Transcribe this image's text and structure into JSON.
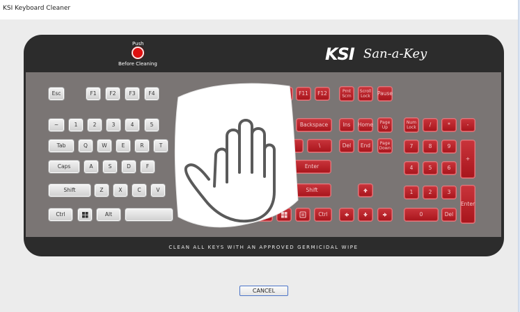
{
  "window": {
    "title": "KSI Keyboard Cleaner"
  },
  "header": {
    "push_label": "Push",
    "before_label": "Before Cleaning",
    "logo_ksi": "KSI",
    "logo_san": "San-a-Key"
  },
  "footer_text": "CLEAN ALL KEYS WITH AN APPROVED GERMICIDAL WIPE",
  "cancel_label": "CANCEL",
  "colors": {
    "key_clean": "#ececec",
    "key_dirty": "#b51f26",
    "frame": "#2c2c2c",
    "push_button": "#e01010"
  },
  "icons": [
    "windows-icon",
    "menu-icon",
    "hand-icon",
    "arrow-up-icon",
    "arrow-down-icon",
    "arrow-left-icon",
    "arrow-right-icon"
  ],
  "keys": [
    {
      "id": "esc",
      "label": "Esc",
      "state": "clean"
    },
    {
      "id": "f1",
      "label": "F1",
      "state": "clean"
    },
    {
      "id": "f2",
      "label": "F2",
      "state": "clean"
    },
    {
      "id": "f3",
      "label": "F3",
      "state": "clean"
    },
    {
      "id": "f4",
      "label": "F4",
      "state": "clean"
    },
    {
      "id": "f10",
      "label": "",
      "state": "dirty"
    },
    {
      "id": "f10b",
      "label": "",
      "state": "dirty"
    },
    {
      "id": "f11",
      "label": "F11",
      "state": "dirty"
    },
    {
      "id": "f12",
      "label": "F12",
      "state": "dirty"
    },
    {
      "id": "prtsc",
      "label": "Prnt Scrn",
      "state": "dirty"
    },
    {
      "id": "scrlk",
      "label": "Scroll Lock",
      "state": "dirty"
    },
    {
      "id": "pause",
      "label": "Pause",
      "state": "dirty"
    },
    {
      "id": "tilde",
      "label": "~",
      "state": "clean"
    },
    {
      "id": "n1",
      "label": "1",
      "state": "clean"
    },
    {
      "id": "n2",
      "label": "2",
      "state": "clean"
    },
    {
      "id": "n3",
      "label": "3",
      "state": "clean"
    },
    {
      "id": "n4",
      "label": "4",
      "state": "clean"
    },
    {
      "id": "n5",
      "label": "5",
      "state": "clean"
    },
    {
      "id": "bksp",
      "label": "Backspace",
      "state": "dirty"
    },
    {
      "id": "ins",
      "label": "Ins",
      "state": "dirty"
    },
    {
      "id": "home",
      "label": "Home",
      "state": "dirty"
    },
    {
      "id": "pgup",
      "label": "Page Up",
      "state": "dirty"
    },
    {
      "id": "numlk",
      "label": "Num Lock",
      "state": "dirty"
    },
    {
      "id": "np_div",
      "label": "/",
      "state": "dirty"
    },
    {
      "id": "np_mul",
      "label": "*",
      "state": "dirty"
    },
    {
      "id": "np_sub",
      "label": "-",
      "state": "dirty"
    },
    {
      "id": "tab",
      "label": "Tab",
      "state": "clean"
    },
    {
      "id": "q",
      "label": "Q",
      "state": "clean"
    },
    {
      "id": "w",
      "label": "W",
      "state": "clean"
    },
    {
      "id": "e",
      "label": "E",
      "state": "clean"
    },
    {
      "id": "r",
      "label": "R",
      "state": "clean"
    },
    {
      "id": "t",
      "label": "T",
      "state": "clean"
    },
    {
      "id": "rbrk",
      "label": "",
      "state": "dirty"
    },
    {
      "id": "bslash",
      "label": "\\",
      "state": "dirty"
    },
    {
      "id": "del",
      "label": "Del",
      "state": "dirty"
    },
    {
      "id": "end",
      "label": "End",
      "state": "dirty"
    },
    {
      "id": "pgdn",
      "label": "Page Down",
      "state": "dirty"
    },
    {
      "id": "np7",
      "label": "7",
      "state": "dirty"
    },
    {
      "id": "np8",
      "label": "8",
      "state": "dirty"
    },
    {
      "id": "np9",
      "label": "9",
      "state": "dirty"
    },
    {
      "id": "np_add",
      "label": "+",
      "state": "dirty"
    },
    {
      "id": "caps",
      "label": "Caps",
      "state": "clean"
    },
    {
      "id": "a",
      "label": "A",
      "state": "clean"
    },
    {
      "id": "s",
      "label": "S",
      "state": "clean"
    },
    {
      "id": "d",
      "label": "D",
      "state": "clean"
    },
    {
      "id": "f",
      "label": "F",
      "state": "clean"
    },
    {
      "id": "enter",
      "label": "Enter",
      "state": "dirty"
    },
    {
      "id": "np4",
      "label": "4",
      "state": "dirty"
    },
    {
      "id": "np5",
      "label": "5",
      "state": "dirty"
    },
    {
      "id": "np6",
      "label": "6",
      "state": "dirty"
    },
    {
      "id": "lshift",
      "label": "Shift",
      "state": "clean"
    },
    {
      "id": "z",
      "label": "Z",
      "state": "clean"
    },
    {
      "id": "x",
      "label": "X",
      "state": "clean"
    },
    {
      "id": "c",
      "label": "C",
      "state": "clean"
    },
    {
      "id": "v",
      "label": "V",
      "state": "clean"
    },
    {
      "id": "rshift",
      "label": "Shift",
      "state": "dirty"
    },
    {
      "id": "up",
      "label": "",
      "icon": "arrow-up-icon",
      "state": "dirty"
    },
    {
      "id": "np1",
      "label": "1",
      "state": "dirty"
    },
    {
      "id": "np2",
      "label": "2",
      "state": "dirty"
    },
    {
      "id": "np3",
      "label": "3",
      "state": "dirty"
    },
    {
      "id": "np_enter",
      "label": "Enter",
      "state": "dirty"
    },
    {
      "id": "lctrl",
      "label": "Ctrl",
      "state": "clean"
    },
    {
      "id": "lwin",
      "label": "",
      "icon": "windows-icon",
      "state": "clean"
    },
    {
      "id": "lalt",
      "label": "Alt",
      "state": "clean"
    },
    {
      "id": "space",
      "label": "",
      "state": "clean"
    },
    {
      "id": "altgr",
      "label": "Alt",
      "state": "dirty"
    },
    {
      "id": "rwin",
      "label": "",
      "icon": "windows-icon",
      "state": "dirty"
    },
    {
      "id": "menu",
      "label": "",
      "icon": "menu-icon",
      "state": "dirty"
    },
    {
      "id": "rctrl",
      "label": "Ctrl",
      "state": "dirty"
    },
    {
      "id": "left",
      "label": "",
      "icon": "arrow-left-icon",
      "state": "dirty"
    },
    {
      "id": "down",
      "label": "",
      "icon": "arrow-down-icon",
      "state": "dirty"
    },
    {
      "id": "right",
      "label": "",
      "icon": "arrow-right-icon",
      "state": "dirty"
    },
    {
      "id": "np0",
      "label": "0",
      "state": "dirty"
    },
    {
      "id": "np_del",
      "label": "Del",
      "state": "dirty"
    }
  ]
}
